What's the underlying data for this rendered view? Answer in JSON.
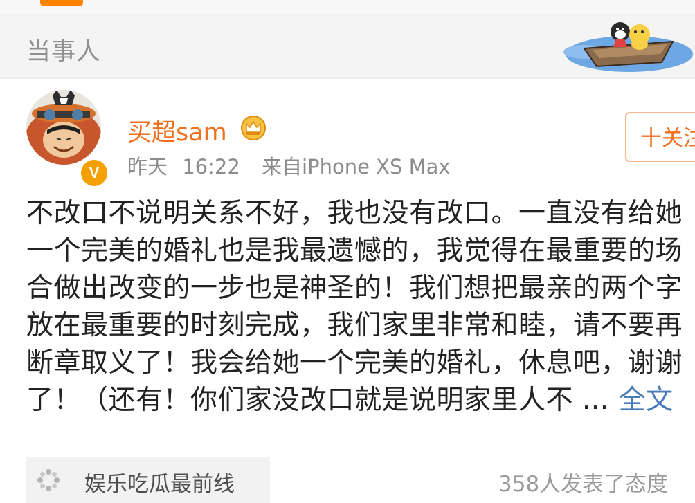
{
  "header": {
    "section_title": "当事人"
  },
  "post": {
    "author": {
      "name": "买超sam",
      "verified_badge": "V",
      "follow_label": "十关注"
    },
    "meta": {
      "date_label": "昨天",
      "time": "16:22",
      "source": "来自iPhone XS Max"
    },
    "content_lines": [
      "不改口不说明关系不好，我也没有改口。一直没有给她",
      "一个完美的婚礼也是我最遗憾的，我觉得在最重要的场",
      "合做出改变的一步也是神圣的！我们想把最亲的两个字",
      "放在最重要的时刻完成，我们家里非常和睦，请不要再",
      "断章取义了！我会给她一个完美的婚礼，休息吧，谢谢",
      "了！（还有！你们家没改口就是说明家里人不 ..."
    ],
    "full_text_link": "全文",
    "topic_card": {
      "label": "娱乐吃瓜最前线"
    },
    "reactions": "358人发表了态度"
  },
  "colors": {
    "accent_orange": "#f06f1c",
    "link_blue": "#4a7bb9",
    "verified_gold": "#f4a100"
  },
  "icons": [
    "crown-icon",
    "verified-icon",
    "topic-icon",
    "boat-illustration"
  ]
}
